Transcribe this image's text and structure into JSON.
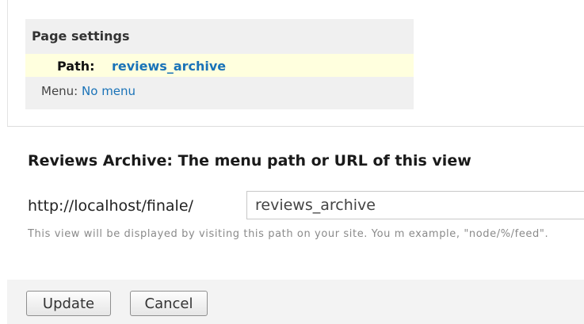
{
  "page_settings": {
    "title": "Page settings",
    "path_label": "Path:",
    "path_value": "reviews_archive",
    "menu_label": "Menu:",
    "menu_value": "No menu"
  },
  "form": {
    "title": "Reviews Archive: The menu path or URL of this view",
    "prefix": "http://localhost/finale/",
    "path_value": "reviews_archive",
    "description": "This view will be displayed by visiting this path on your site. You m example, \"node/%/feed\"."
  },
  "buttons": {
    "update": "Update",
    "cancel": "Cancel"
  },
  "colors": {
    "link": "#1a73b8",
    "highlight": "#ffffde",
    "panel": "#f0f0f0"
  }
}
